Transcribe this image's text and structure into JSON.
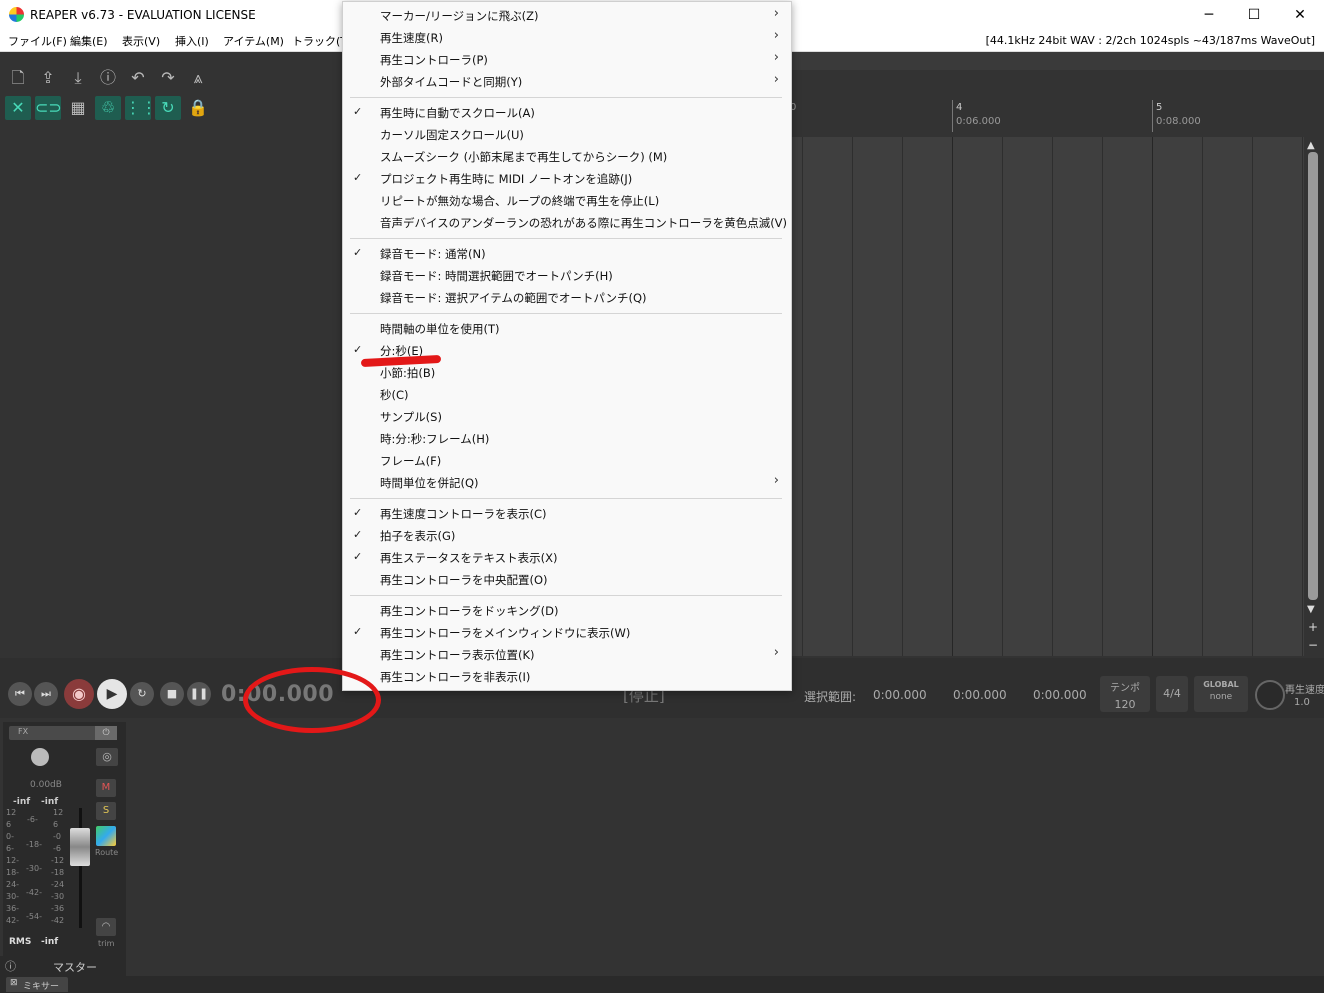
{
  "window": {
    "title": "REAPER v6.73 - EVALUATION LICENSE",
    "minimize": "─",
    "maximize": "☐",
    "close": "✕"
  },
  "menubar": {
    "items": [
      "ファイル(F)",
      "編集(E)",
      "表示(V)",
      "挿入(I)",
      "アイテム(M)",
      "トラック(T)"
    ],
    "status": "[44.1kHz 24bit WAV : 2/2ch 1024spls ~43/187ms WaveOut]"
  },
  "ruler": {
    "labels": [
      "0",
      "4",
      "0:06.000",
      "5",
      "0:08.000"
    ]
  },
  "transport": {
    "time": "0:00.000",
    "state": "[停止]",
    "selection_label": "選択範囲:",
    "sel_start": "0:00.000",
    "sel_end": "0:00.000",
    "sel_length": "0:00.000",
    "tempo_label": "テンポ",
    "tempo": "120",
    "timesig": "4/4",
    "global_label": "GLOBAL",
    "global_value": "none",
    "rate_label": "再生速度",
    "rate": "1.0"
  },
  "mixer": {
    "fx_label": "FX",
    "volume": "0.00dB",
    "peak_l": "-inf",
    "peak_r": "-inf",
    "mute": "M",
    "solo": "S",
    "route": "Route",
    "trim": "trim",
    "rms": "RMS",
    "rms_value": "-inf",
    "scale_left": [
      "12",
      "6",
      "0-",
      "6-",
      "12-",
      "18-",
      "24-",
      "30-",
      "36-",
      "42-"
    ],
    "scale_mid": [
      "-6-",
      "-18-",
      "-30-",
      "-42-",
      "-54-"
    ],
    "scale_right": [
      "12",
      "6",
      "-0",
      "-6",
      "-12",
      "-18",
      "-24",
      "-30",
      "-36",
      "-42"
    ],
    "master_label": "マスター",
    "mixer_tab": "ミキサー"
  },
  "menu": {
    "groups": [
      [
        {
          "label": "マーカー/リージョンに飛ぶ(Z)",
          "checked": false,
          "submenu": true
        },
        {
          "label": "再生速度(R)",
          "checked": false,
          "submenu": true
        },
        {
          "label": "再生コントローラ(P)",
          "checked": false,
          "submenu": true
        },
        {
          "label": "外部タイムコードと同期(Y)",
          "checked": false,
          "submenu": true
        }
      ],
      [
        {
          "label": "再生時に自動でスクロール(A)",
          "checked": true,
          "submenu": false
        },
        {
          "label": "カーソル固定スクロール(U)",
          "checked": false,
          "submenu": false
        },
        {
          "label": "スムーズシーク (小節末尾まで再生してからシーク) (M)",
          "checked": false,
          "submenu": false
        },
        {
          "label": "プロジェクト再生時に MIDI ノートオンを追跡(J)",
          "checked": true,
          "submenu": false
        },
        {
          "label": "リピートが無効な場合、ループの終端で再生を停止(L)",
          "checked": false,
          "submenu": false
        },
        {
          "label": "音声デバイスのアンダーランの恐れがある際に再生コントローラを黄色点滅(V)",
          "checked": false,
          "submenu": false
        }
      ],
      [
        {
          "label": "録音モード: 通常(N)",
          "checked": true,
          "submenu": false
        },
        {
          "label": "録音モード: 時間選択範囲でオートパンチ(H)",
          "checked": false,
          "submenu": false
        },
        {
          "label": "録音モード: 選択アイテムの範囲でオートパンチ(Q)",
          "checked": false,
          "submenu": false
        }
      ],
      [
        {
          "label": "時間軸の単位を使用(T)",
          "checked": false,
          "submenu": false
        },
        {
          "label": "分:秒(E)",
          "checked": true,
          "submenu": false
        },
        {
          "label": "小節:拍(B)",
          "checked": false,
          "submenu": false
        },
        {
          "label": "秒(C)",
          "checked": false,
          "submenu": false
        },
        {
          "label": "サンプル(S)",
          "checked": false,
          "submenu": false
        },
        {
          "label": "時:分:秒:フレーム(H)",
          "checked": false,
          "submenu": false
        },
        {
          "label": "フレーム(F)",
          "checked": false,
          "submenu": false
        },
        {
          "label": "時間単位を併記(Q)",
          "checked": false,
          "submenu": true
        }
      ],
      [
        {
          "label": "再生速度コントローラを表示(C)",
          "checked": true,
          "submenu": false
        },
        {
          "label": "拍子を表示(G)",
          "checked": true,
          "submenu": false
        },
        {
          "label": "再生ステータスをテキスト表示(X)",
          "checked": true,
          "submenu": false
        },
        {
          "label": "再生コントローラを中央配置(O)",
          "checked": false,
          "submenu": false
        }
      ],
      [
        {
          "label": "再生コントローラをドッキング(D)",
          "checked": false,
          "submenu": false
        },
        {
          "label": "再生コントローラをメインウィンドウに表示(W)",
          "checked": true,
          "submenu": false
        },
        {
          "label": "再生コントローラ表示位置(K)",
          "checked": false,
          "submenu": true
        },
        {
          "label": "再生コントローラを非表示(I)",
          "checked": false,
          "submenu": false
        }
      ]
    ]
  }
}
